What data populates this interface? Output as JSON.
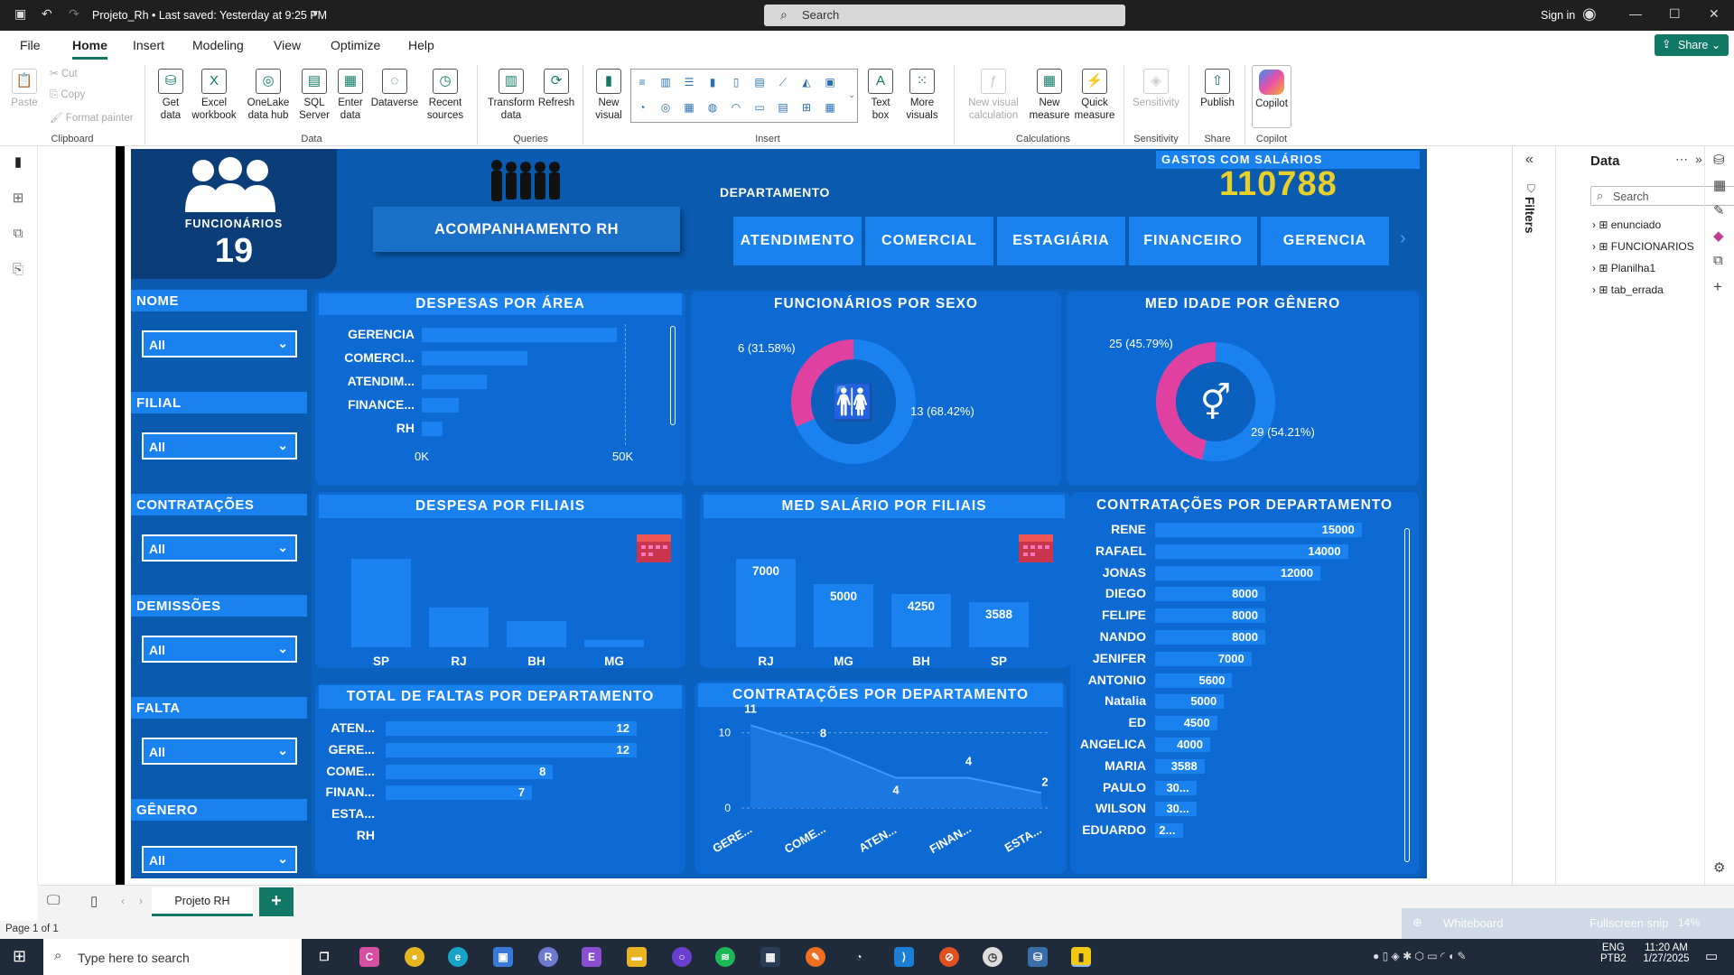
{
  "titlebar": {
    "title": "Projeto_Rh • Last saved: Yesterday at 9:25 PM",
    "search_placeholder": "Search",
    "signin": "Sign in"
  },
  "menu": {
    "tabs": [
      "File",
      "Home",
      "Insert",
      "Modeling",
      "View",
      "Optimize",
      "Help"
    ],
    "share": "Share"
  },
  "ribbon": {
    "clipboard": {
      "paste": "Paste",
      "cut": "Cut",
      "copy": "Copy",
      "format_painter": "Format painter",
      "group": "Clipboard"
    },
    "data": {
      "get_data": "Get data",
      "excel": "Excel workbook",
      "onelake": "OneLake data hub",
      "sql": "SQL Server",
      "enter": "Enter data",
      "dataverse": "Dataverse",
      "recent": "Recent sources",
      "group": "Data"
    },
    "queries": {
      "transform": "Transform data",
      "refresh": "Refresh",
      "group": "Queries"
    },
    "insert": {
      "new_visual": "New visual",
      "text_box": "Text box",
      "more_visuals": "More visuals",
      "group": "Insert"
    },
    "calculations": {
      "new_visual_calc": "New visual calculation",
      "new_measure": "New measure",
      "quick_measure": "Quick measure",
      "group": "Calculations"
    },
    "sensitivity": {
      "label": "Sensitivity",
      "group": "Sensitivity"
    },
    "share": {
      "publish": "Publish",
      "group": "Share"
    },
    "copilot": {
      "label": "Copilot",
      "group": "Copilot"
    }
  },
  "report": {
    "funcionarios": {
      "label": "FUNCIONÁRIOS",
      "value": "19"
    },
    "acompanhamento": "ACOMPANHAMENTO RH",
    "departamento_label": "DEPARTAMENTO",
    "departamentos": [
      "ATENDIMENTO",
      "COMERCIAL",
      "ESTAGIÁRIA",
      "FINANCEIRO",
      "GERENCIA"
    ],
    "gastos": {
      "label": "GASTOS COM SALÁRIOS",
      "value": "110788"
    },
    "slicers": [
      {
        "label": "NOME",
        "value": "All"
      },
      {
        "label": "FILIAL",
        "value": "All"
      },
      {
        "label": "CONTRATAÇÕES",
        "value": "All"
      },
      {
        "label": "DEMISSÕES",
        "value": "All"
      },
      {
        "label": "FALTA",
        "value": "All"
      },
      {
        "label": "GÊNERO",
        "value": "All"
      }
    ],
    "titles": {
      "despesas_area": "DESPESAS POR ÁREA",
      "func_sexo": "FUNCIONÁRIOS POR SEXO",
      "med_idade": "MED IDADE POR GÊNERO",
      "despesa_filiais": "DESPESA POR FILIAIS",
      "med_salario": "MED SALÁRIO POR FILIAIS",
      "contrat_dept_bar": "CONTRATAÇÕES POR DEPARTAMENTO",
      "faltas": "TOTAL DE FALTAS POR DEPARTAMENTO",
      "contrat_dept_line": "CONTRATAÇÕES POR DEPARTAMENTO"
    }
  },
  "chart_data": [
    {
      "type": "bar",
      "orientation": "horizontal",
      "title": "DESPESAS POR ÁREA",
      "categories": [
        "GERENCIA",
        "COMERCI...",
        "ATENDIM...",
        "FINANCE...",
        "RH"
      ],
      "values": [
        48000,
        26000,
        16000,
        9000,
        5000
      ],
      "ticks": [
        "0K",
        "50K"
      ],
      "xlim": [
        0,
        50000
      ]
    },
    {
      "type": "pie",
      "donut": true,
      "title": "FUNCIONÁRIOS POR SEXO",
      "values": [
        6,
        13
      ],
      "labels": [
        "6 (31.58%)",
        "13 (68.42%)"
      ],
      "colors": [
        "#e040a0",
        "#1a82ef"
      ]
    },
    {
      "type": "pie",
      "donut": true,
      "title": "MED IDADE POR GÊNERO",
      "values": [
        25,
        29
      ],
      "labels": [
        "25 (45.79%)",
        "29 (54.21%)"
      ],
      "colors": [
        "#e040a0",
        "#1a82ef"
      ]
    },
    {
      "type": "bar",
      "title": "DESPESA POR FILIAIS",
      "categories": [
        "SP",
        "RJ",
        "BH",
        "MG"
      ],
      "values": [
        58000,
        26000,
        17000,
        5000
      ]
    },
    {
      "type": "bar",
      "title": "MED SALÁRIO POR FILIAIS",
      "categories": [
        "RJ",
        "MG",
        "BH",
        "SP"
      ],
      "values": [
        7000,
        5000,
        4250,
        3588
      ],
      "labels": [
        "7000",
        "5000",
        "4250",
        "3588"
      ]
    },
    {
      "type": "bar",
      "orientation": "horizontal",
      "title": "CONTRATAÇÕES POR DEPARTAMENTO",
      "categories": [
        "RENE",
        "RAFAEL",
        "JONAS",
        "DIEGO",
        "FELIPE",
        "NANDO",
        "JENIFER",
        "ANTONIO",
        "Natalia",
        "ED",
        "ANGELICA",
        "MARIA",
        "PAULO",
        "WILSON",
        "EDUARDO"
      ],
      "values": [
        15000,
        14000,
        12000,
        8000,
        8000,
        8000,
        7000,
        5600,
        5000,
        4500,
        4000,
        3588,
        3000,
        3000,
        2000
      ],
      "labels": [
        "15000",
        "14000",
        "12000",
        "8000",
        "8000",
        "8000",
        "7000",
        "5600",
        "5000",
        "4500",
        "4000",
        "3588",
        "30...",
        "30...",
        "2..."
      ]
    },
    {
      "type": "bar",
      "orientation": "horizontal",
      "title": "TOTAL DE FALTAS POR DEPARTAMENTO",
      "categories": [
        "ATEN...",
        "GERE...",
        "COME...",
        "FINAN...",
        "ESTA...",
        "RH"
      ],
      "values": [
        12,
        12,
        8,
        7,
        0,
        0
      ],
      "labels": [
        "12",
        "12",
        "8",
        "7",
        "",
        ""
      ]
    },
    {
      "type": "area",
      "title": "CONTRATAÇÕES POR DEPARTAMENTO",
      "categories": [
        "GERE...",
        "COME...",
        "ATEN...",
        "FINAN...",
        "ESTA..."
      ],
      "values": [
        11,
        8,
        4,
        4,
        2
      ],
      "yticks": [
        "0",
        "10"
      ],
      "ylim": [
        0,
        12
      ]
    }
  ],
  "right_panel": {
    "title": "Data",
    "search_placeholder": "Search",
    "filters_label": "Filters",
    "tables": [
      "enunciado",
      "FUNCIONARIOS",
      "Planilha1",
      "tab_errada"
    ]
  },
  "pages": {
    "tab": "Projeto RH",
    "add": "+"
  },
  "status": {
    "page": "Page 1 of 1",
    "zoom": "14%",
    "whiteboard": "Whiteboard",
    "fullscreen": "Fullscreen snip"
  },
  "taskbar": {
    "search_placeholder": "Type here to search",
    "lang": "ENG",
    "layout": "PTB2",
    "time": "11:20 AM",
    "date": "1/27/2025"
  }
}
